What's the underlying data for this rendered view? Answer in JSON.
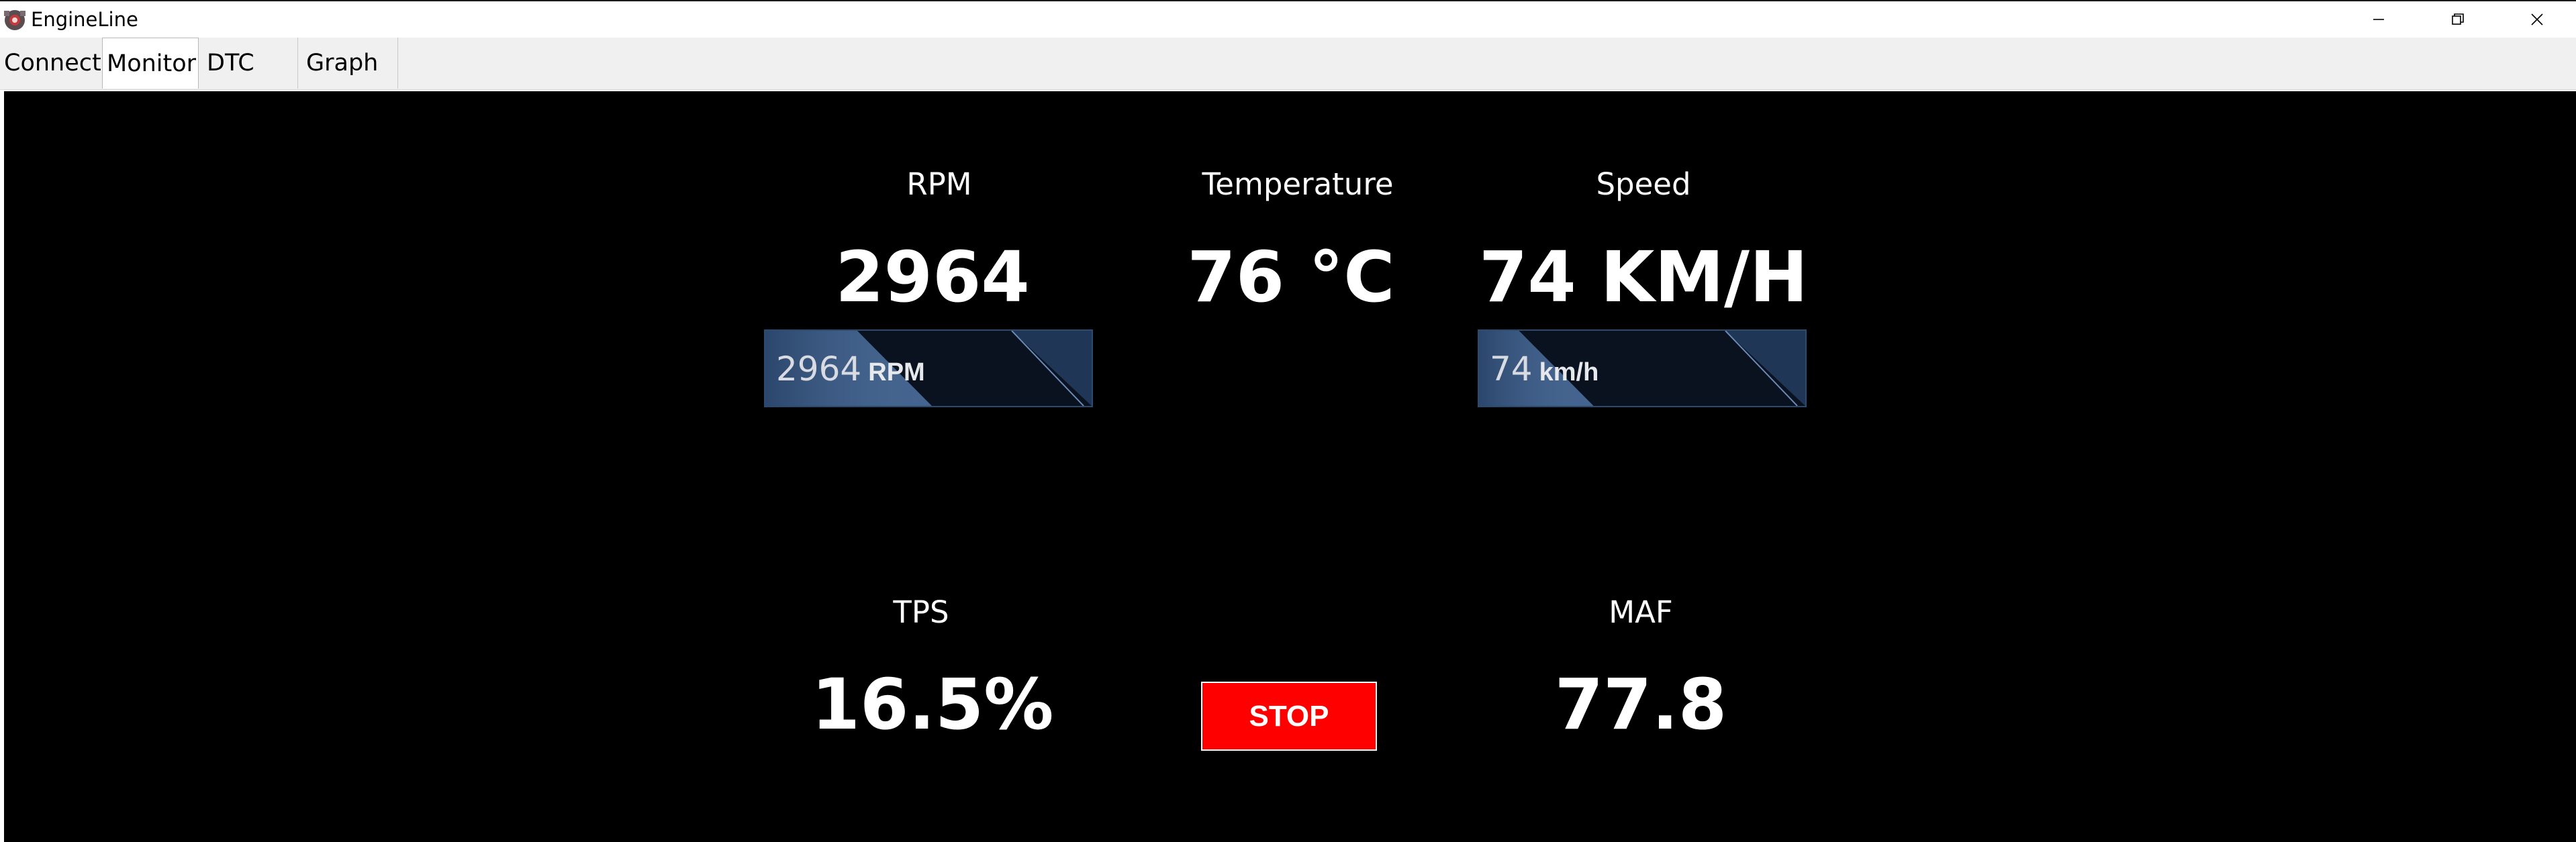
{
  "window": {
    "title": "EngineLine",
    "controls": [
      "minimize-icon",
      "restore-icon",
      "close-icon"
    ]
  },
  "tabs": [
    {
      "label": "Connect",
      "active": false
    },
    {
      "label": "Monitor",
      "active": true
    },
    {
      "label": "DTC",
      "active": false
    },
    {
      "label": "Graph",
      "active": false
    }
  ],
  "monitor": {
    "rpm": {
      "label": "RPM",
      "value": "2964",
      "bar_value": "2964",
      "bar_unit": "RPM"
    },
    "temperature": {
      "label": "Temperature",
      "value": "76 °C"
    },
    "speed": {
      "label": "Speed",
      "value": "74 KM/H",
      "bar_value": "74",
      "bar_unit": "km/h"
    },
    "tps": {
      "label": "TPS",
      "value": "16.5%"
    },
    "maf": {
      "label": "MAF",
      "value": "77.8"
    },
    "stop_label": "STOP"
  },
  "colors": {
    "dashboard_bg": "#000000",
    "stop_button": "#ff0000",
    "bar_border": "#2a4a6e",
    "bar_fill": "#3b5b86"
  }
}
